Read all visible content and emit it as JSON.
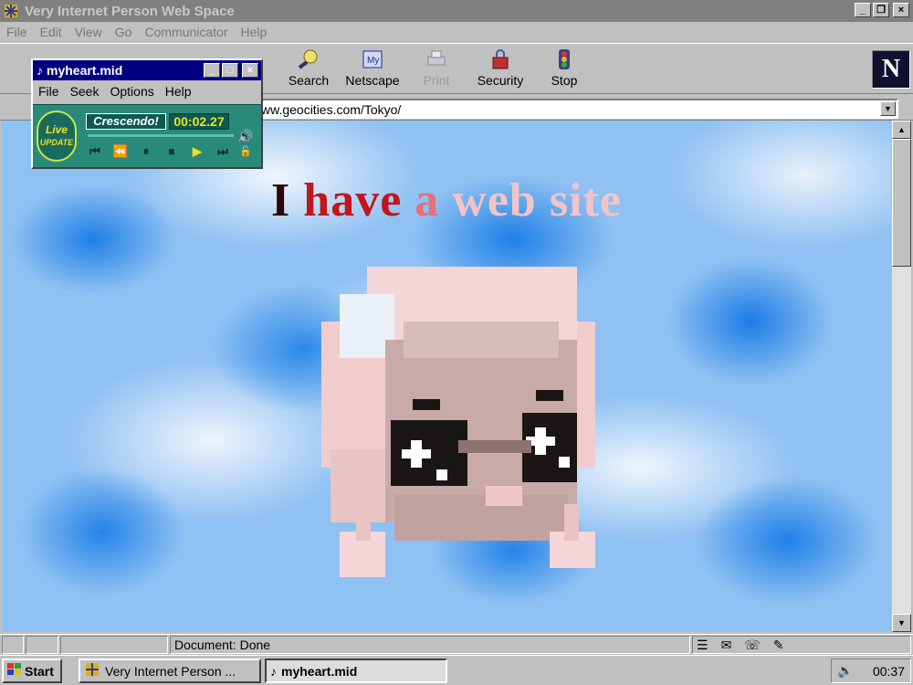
{
  "window": {
    "title": "Very Internet Person Web Space",
    "buttons": [
      "_",
      "❐",
      "×"
    ]
  },
  "menubar": [
    "File",
    "Edit",
    "View",
    "Go",
    "Communicator",
    "Help"
  ],
  "toolbar": {
    "buttons": [
      {
        "label": "Search",
        "icon": "search-icon",
        "enabled": true
      },
      {
        "label": "Netscape",
        "icon": "netscape-icon",
        "enabled": true
      },
      {
        "label": "Print",
        "icon": "printer-icon",
        "enabled": false
      },
      {
        "label": "Security",
        "icon": "lock-icon",
        "enabled": true
      },
      {
        "label": "Stop",
        "icon": "stop-icon",
        "enabled": true
      }
    ],
    "logo": "N"
  },
  "location": {
    "url": "ww.geocities.com/Tokyo/"
  },
  "page": {
    "headline": {
      "w1": "I",
      "w2": "have",
      "w3": "a",
      "w4": "web site"
    },
    "colors": {
      "w1": "#2e0508",
      "w2": "#c0161d",
      "w3": "#e8707a",
      "w4": "#f2c3c8"
    }
  },
  "status": {
    "text": "Document: Done"
  },
  "player": {
    "title": "myheart.mid",
    "menu": [
      "File",
      "Seek",
      "Options",
      "Help"
    ],
    "brand": "Crescendo!",
    "time": "00:02.27",
    "badge": {
      "line1": "Live",
      "line2": "UPDATE"
    },
    "controls": [
      "⏮",
      "⏪",
      "⏸",
      "⏹",
      "▶",
      "⏭"
    ]
  },
  "taskbar": {
    "start": "Start",
    "tasks": [
      "Very Internet Person ...",
      "myheart.mid"
    ],
    "clock": "00:37"
  }
}
